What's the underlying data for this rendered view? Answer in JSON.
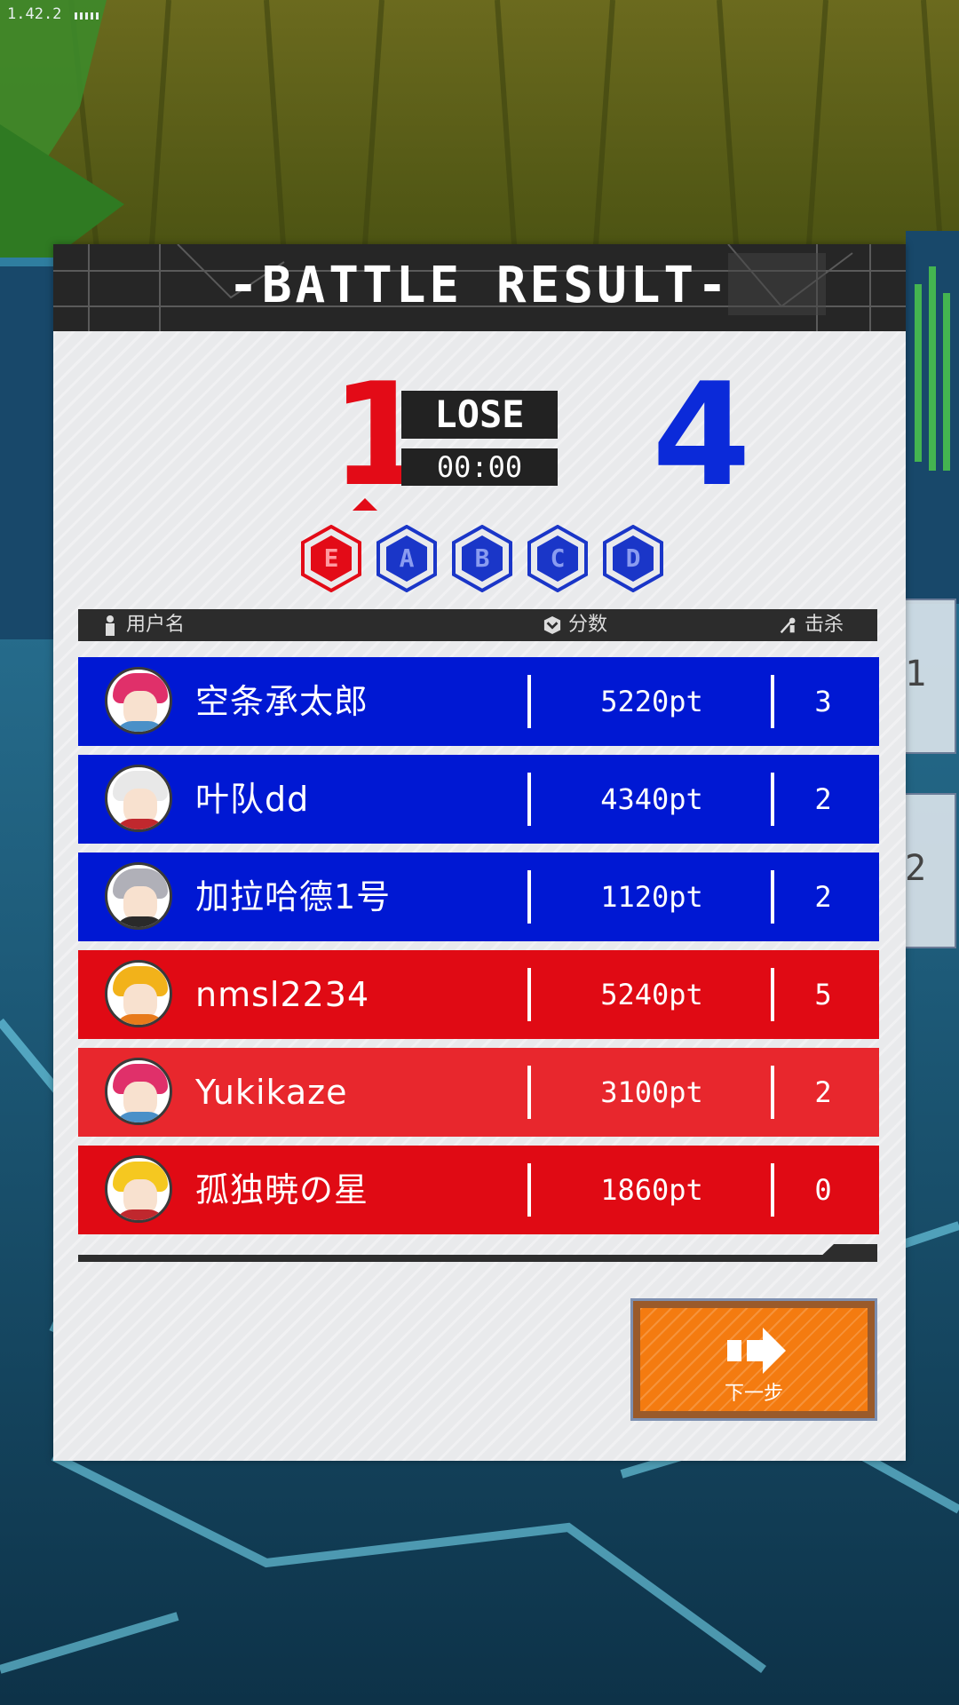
{
  "version": "1.42.2",
  "header": {
    "title": "-BATTLE RESULT-"
  },
  "match": {
    "left_score": "1",
    "right_score": "4",
    "result": "LOSE",
    "time": "00:00"
  },
  "badges": [
    {
      "letter": "E",
      "team": "red",
      "color": "#e30b17"
    },
    {
      "letter": "A",
      "team": "blue",
      "color": "#1a36c8"
    },
    {
      "letter": "B",
      "team": "blue",
      "color": "#1a36c8"
    },
    {
      "letter": "C",
      "team": "blue",
      "color": "#1a36c8"
    },
    {
      "letter": "D",
      "team": "blue",
      "color": "#1a36c8"
    }
  ],
  "table": {
    "columns": {
      "username": "用户名",
      "score": "分数",
      "kills": "击杀"
    },
    "rows": [
      {
        "name": "空条承太郎",
        "points": "5220pt",
        "kills": "3",
        "team": "blue",
        "hair": "#e0306a",
        "outfit": "#4a90c8"
      },
      {
        "name": "叶队dd",
        "points": "4340pt",
        "kills": "2",
        "team": "blue",
        "hair": "#e8e8e8",
        "outfit": "#c0282e"
      },
      {
        "name": "加拉哈德1号",
        "points": "1120pt",
        "kills": "2",
        "team": "blue",
        "hair": "#b0b0b8",
        "outfit": "#2a2a2a"
      },
      {
        "name": "nmsl2234",
        "points": "5240pt",
        "kills": "5",
        "team": "red",
        "hair": "#f2b21a",
        "outfit": "#e87a1a"
      },
      {
        "name": "Yukikaze",
        "points": "3100pt",
        "kills": "2",
        "team": "red",
        "hair": "#e0306a",
        "outfit": "#4a90c8"
      },
      {
        "name": "孤独暁の星",
        "points": "1860pt",
        "kills": "0",
        "team": "red",
        "hair": "#f5c820",
        "outfit": "#c0282e"
      }
    ]
  },
  "next_button": {
    "label": "下一步"
  },
  "side_tabs": [
    "1",
    "2"
  ],
  "colors": {
    "blue_team": "#0018d3",
    "red_team": "#e00a14",
    "next_button": "#f47b10"
  }
}
